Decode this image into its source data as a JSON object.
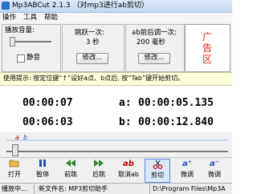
{
  "window": {
    "title": "Mp3ABCut 2.1.3 （对mp3进行ab剪切）"
  },
  "menu": {
    "items": [
      "操作",
      "工具",
      "帮助"
    ]
  },
  "volume": {
    "label": "播放音量:",
    "mute_label": "静音",
    "mute_checked": false,
    "level": 0.05
  },
  "skip": {
    "label": "跳跃一次:",
    "value": "3  秒",
    "button": "修改..."
  },
  "fine": {
    "label": "ab前后调一次:",
    "value": "200  毫秒",
    "button": "修改..."
  },
  "ad": {
    "chars": [
      "广",
      "告",
      "区"
    ]
  },
  "hint": {
    "text": "使用提示: 按定位键“↑”设好a点、b点后, 按“Tab”键开始剪切。"
  },
  "times": {
    "current": "00:00:07",
    "total": "00:06:03",
    "a_label": "a:",
    "a_value": "00:00:05.135",
    "b_label": "b:",
    "b_value": "00:00:12.840"
  },
  "seek": {
    "marker_a": "a",
    "marker_b": "b",
    "position": 0.03
  },
  "toolbar": {
    "items": [
      "打开",
      "暂停",
      "前跳",
      "后跳",
      "取消ab",
      "剪切",
      "微调",
      "微调"
    ]
  },
  "toolbar_icons": {
    "open": "folder-icon",
    "pause": "pause-icon",
    "prev": "skip-back-icon",
    "next": "skip-forward-icon",
    "cancel": "ab-cancel-icon",
    "cut": "scissors-icon",
    "fine1": "a-plus-icon",
    "fine2": "b-plus-icon"
  },
  "status": {
    "left": "播放中...",
    "middle": "新文件名: MP3剪切助手",
    "right": "D:\\Program Files\\Mp3A"
  },
  "colors": {
    "ad_text": "#e02020",
    "hint_bg": "#ffffd9",
    "accent": "#2c6fcf",
    "cut_red": "#c00000"
  }
}
